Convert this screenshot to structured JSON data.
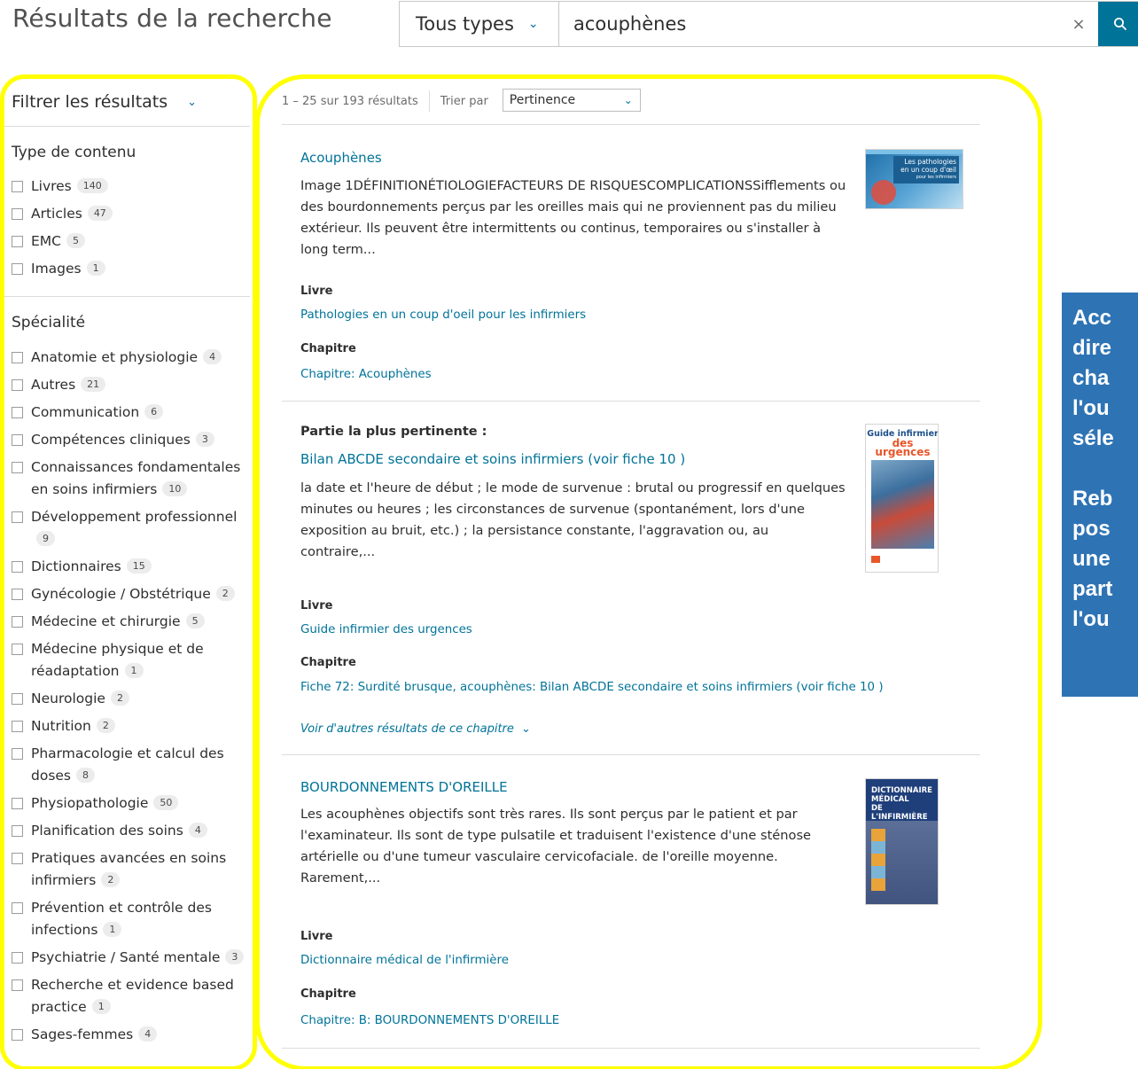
{
  "header": {
    "title": "Résultats de la recherche",
    "type_select": "Tous types",
    "search_value": "acouphènes",
    "clear_icon": "×"
  },
  "sidebar": {
    "filter_label": "Filtrer les résultats",
    "content_type": {
      "title": "Type de contenu",
      "items": [
        {
          "label": "Livres",
          "count": "140"
        },
        {
          "label": "Articles",
          "count": "47"
        },
        {
          "label": "EMC",
          "count": "5"
        },
        {
          "label": "Images",
          "count": "1"
        }
      ]
    },
    "specialty": {
      "title": "Spécialité",
      "items": [
        {
          "label": "Anatomie et physiologie",
          "count": "4"
        },
        {
          "label": "Autres",
          "count": "21"
        },
        {
          "label": "Communication",
          "count": "6"
        },
        {
          "label": "Compétences cliniques",
          "count": "3"
        },
        {
          "label": "Connaissances fondamentales en soins infirmiers",
          "count": "10"
        },
        {
          "label": "Développement professionnel",
          "count": "9"
        },
        {
          "label": "Dictionnaires",
          "count": "15"
        },
        {
          "label": "Gynécologie / Obstétrique",
          "count": "2"
        },
        {
          "label": "Médecine et chirurgie",
          "count": "5"
        },
        {
          "label": "Médecine physique et de réadaptation",
          "count": "1"
        },
        {
          "label": "Neurologie",
          "count": "2"
        },
        {
          "label": "Nutrition",
          "count": "2"
        },
        {
          "label": "Pharmacologie et calcul des doses",
          "count": "8"
        },
        {
          "label": "Physiopathologie",
          "count": "50"
        },
        {
          "label": "Planification des soins",
          "count": "4"
        },
        {
          "label": "Pratiques avancées en soins infirmiers",
          "count": "2"
        },
        {
          "label": "Prévention et contrôle des infections",
          "count": "1"
        },
        {
          "label": "Psychiatrie / Santé mentale",
          "count": "3"
        },
        {
          "label": "Recherche et evidence based practice",
          "count": "1"
        },
        {
          "label": "Sages-femmes",
          "count": "4"
        }
      ]
    }
  },
  "results_bar": {
    "count_text": "1 – 25 sur 193 résultats",
    "sort_label": "Trier par",
    "sort_value": "Pertinence"
  },
  "results": [
    {
      "title": "Acouphènes",
      "snippet": "Image 1DÉFINITIONÉTIOLOGIEFACTEURS DE RISQUESCOMPLICATIONSSifflements ou des bourdonnements perçus par les oreilles mais qui ne proviennent pas du milieu extérieur. Ils peuvent être intermittents ou continus, temporaires ou s'installer à long term...",
      "book_label": "Livre",
      "book": "Pathologies en un coup d'oeil pour les infirmiers",
      "chapter_label": "Chapitre",
      "chapter": "Chapitre: Acouphènes",
      "thumb": {
        "line1": "Les pathologies",
        "line2": "en un coup d'œil",
        "line3": "pour les infirmiers"
      }
    },
    {
      "most_relevant": "Partie la plus pertinente :",
      "title": "Bilan ABCDE secondaire et soins infirmiers (voir fiche 10 )",
      "snippet": "la date et l'heure de début ; le mode de survenue : brutal ou progressif en quelques minutes ou heures ; les circonstances de survenue (spontanément, lors d'une exposition au bruit, etc.) ; la persistance constante, l'aggravation ou, au contraire,...",
      "book_label": "Livre",
      "book": "Guide infirmier des urgences",
      "chapter_label": "Chapitre",
      "chapter": "Fiche 72: Surdité brusque, acouphènes: Bilan ABCDE secondaire et soins infirmiers (voir fiche 10 )",
      "more_link": "Voir d'autres résultats de ce chapitre",
      "thumb": {
        "line1": "Guide infirmier",
        "line2": "des urgences"
      }
    },
    {
      "title": "BOURDONNEMENTS D'OREILLE",
      "snippet": "Les acouphènes objectifs sont très rares. Ils sont perçus par le patient et par l'examinateur. Ils sont de type pulsatile et traduisent l'existence d'une sténose artérielle ou d'une tumeur vasculaire cervicofaciale. de l'oreille moyenne. Rarement,...",
      "book_label": "Livre",
      "book": "Dictionnaire médical de l'infirmière",
      "chapter_label": "Chapitre",
      "chapter": "Chapitre: B: BOURDONNEMENTS D'OREILLE",
      "thumb": {
        "line1": "DICTIONNAIRE",
        "line2": "MÉDICAL",
        "line3": "DE L'INFIRMIÈRE"
      }
    }
  ],
  "callout": {
    "lines1": [
      "Acc",
      "dire",
      "cha",
      "l'ou",
      "séle"
    ],
    "lines2": [
      "Reb",
      "pos",
      "une",
      "part",
      "l'ou"
    ]
  },
  "colors": {
    "accent": "#007398",
    "highlight": "#ffff00",
    "callout_bg": "#2e74b5"
  }
}
